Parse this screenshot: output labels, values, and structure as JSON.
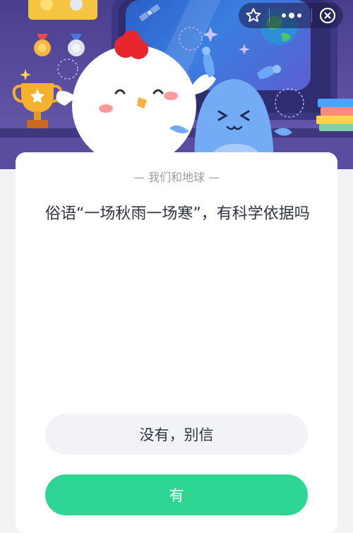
{
  "header": {
    "icons": [
      "star-icon",
      "more-icon",
      "close-icon"
    ]
  },
  "quiz": {
    "category": "— 我们和地球 —",
    "question": "俗语“一场秋雨一场寒”，有科学依据吗",
    "options": [
      {
        "label": "没有，别信"
      },
      {
        "label": "有"
      }
    ]
  },
  "colors": {
    "banner": "#5e50a3",
    "accent": "#2fd593",
    "option_bg": "#f2f3f6",
    "text": "#2f3440",
    "muted": "#9a9ca3"
  }
}
